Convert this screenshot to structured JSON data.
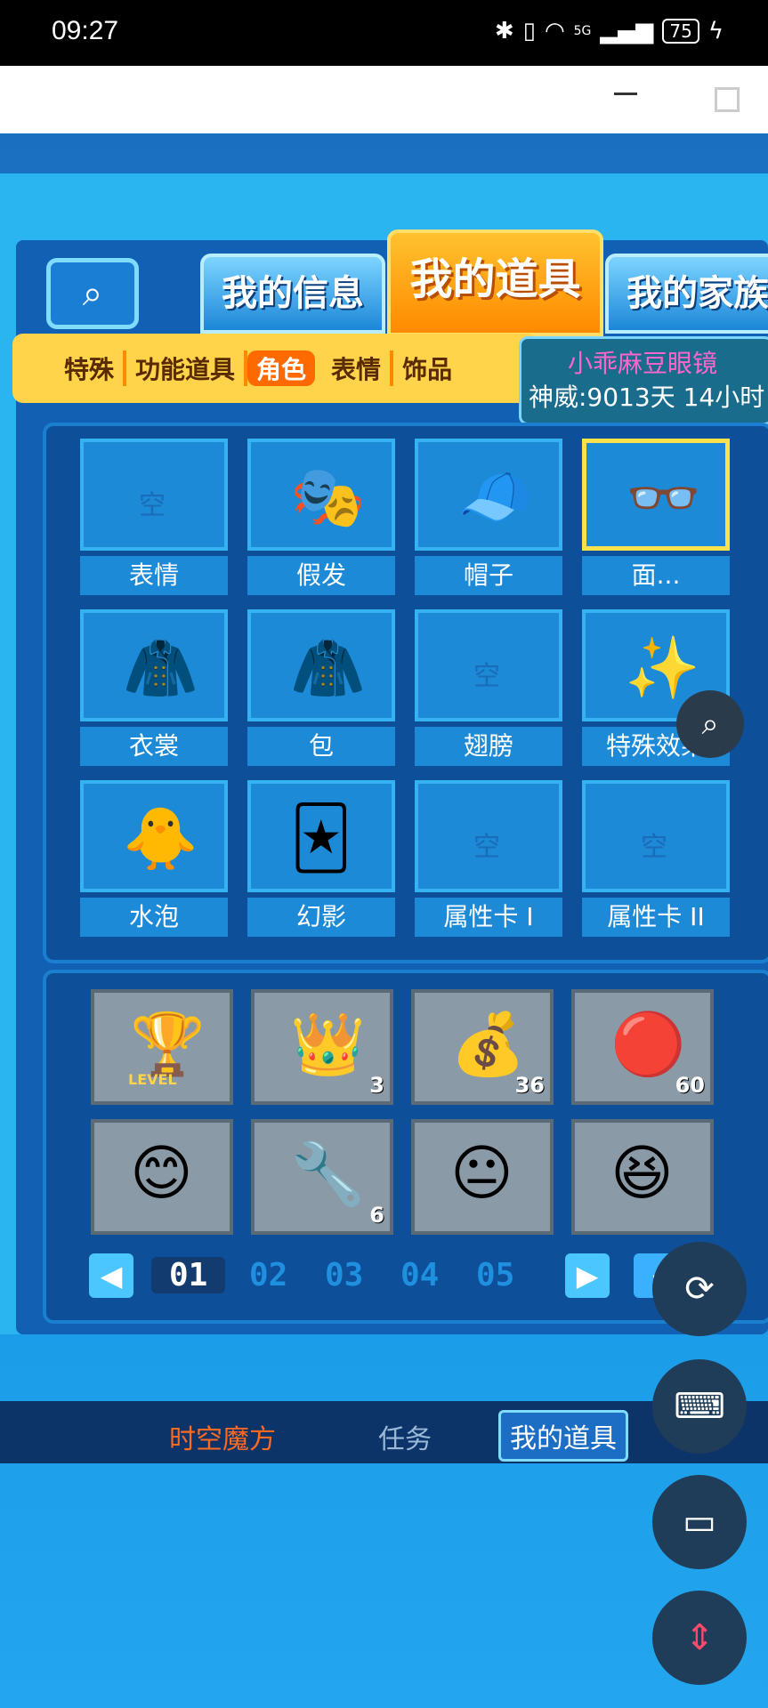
{
  "status": {
    "time": "09:27",
    "battery": "75",
    "signal": "5G"
  },
  "main_tabs": {
    "my_info": "我的信息",
    "my_items": "我的道具",
    "my_family": "我的家族"
  },
  "sub_tabs": [
    "特殊",
    "功能道具",
    "角色",
    "表情",
    "饰品"
  ],
  "tooltip": {
    "name": "小乖麻豆眼镜",
    "duration": "神威:9013天 14小时"
  },
  "equip_slots": [
    {
      "label": "表情",
      "empty_mark": "空"
    },
    {
      "label": "假发"
    },
    {
      "label": "帽子"
    },
    {
      "label": "面..."
    },
    {
      "label": "衣裳"
    },
    {
      "label": "包"
    },
    {
      "label": "翅膀",
      "empty_mark": "空"
    },
    {
      "label": "特殊效果"
    },
    {
      "label": "水泡"
    },
    {
      "label": "幻影"
    },
    {
      "label": "属性卡 I",
      "empty_mark": "空"
    },
    {
      "label": "属性卡 II",
      "empty_mark": "空"
    }
  ],
  "inventory": [
    {
      "icon": "level-chest-icon",
      "qty": "",
      "text": "LEVEL"
    },
    {
      "icon": "crown-bag-icon",
      "qty": "3"
    },
    {
      "icon": "coin-chest-icon",
      "qty": "36"
    },
    {
      "icon": "dragon-ball-icon",
      "qty": "60"
    },
    {
      "icon": "smiley-icon",
      "qty": ""
    },
    {
      "icon": "wrench-icon",
      "qty": "6"
    },
    {
      "icon": "headband-smiley-icon",
      "qty": ""
    },
    {
      "icon": "flower-smiley-icon",
      "qty": ""
    }
  ],
  "pages": [
    "01",
    "02",
    "03",
    "04",
    "05"
  ],
  "bottom": {
    "time_cube": "时空魔方",
    "task": "任务",
    "my_items": "我的道具"
  },
  "empty_mark": "空"
}
